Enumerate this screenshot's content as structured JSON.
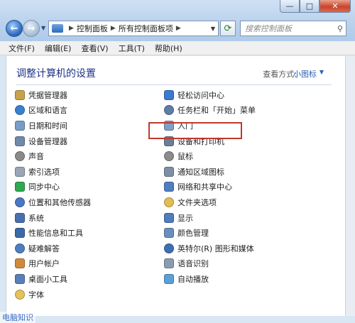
{
  "address": {
    "crumb1": "控制面板",
    "crumb2": "所有控制面板项"
  },
  "search": {
    "placeholder": "搜索控制面板"
  },
  "menu": [
    "文件(F)",
    "编辑(E)",
    "查看(V)",
    "工具(T)",
    "帮助(H)"
  ],
  "heading": "调整计算机的设置",
  "view": {
    "label": "查看方式:",
    "value": "小图标"
  },
  "items_left": [
    {
      "label": "凭据管理器",
      "color": "#c8a24a"
    },
    {
      "label": "区域和语言",
      "color": "#3b7fd1"
    },
    {
      "label": "日期和时间",
      "color": "#7a9cc6"
    },
    {
      "label": "设备管理器",
      "color": "#6f8aa8"
    },
    {
      "label": "声音",
      "color": "#8a8a8a"
    },
    {
      "label": "索引选项",
      "color": "#9aa6b5"
    },
    {
      "label": "同步中心",
      "color": "#2fa84f"
    },
    {
      "label": "位置和其他传感器",
      "color": "#4b78c2"
    },
    {
      "label": "系统",
      "color": "#4a6fb0"
    },
    {
      "label": "性能信息和工具",
      "color": "#3b6aa8"
    },
    {
      "label": "疑难解答",
      "color": "#4d7fc0"
    },
    {
      "label": "用户帐户",
      "color": "#d08a3a"
    },
    {
      "label": "桌面小工具",
      "color": "#5a7fb8"
    },
    {
      "label": "字体",
      "color": "#e3c35a"
    }
  ],
  "items_right": [
    {
      "label": "轻松访问中心",
      "color": "#3a7ad0"
    },
    {
      "label": "任务栏和「开始」菜单",
      "color": "#5c7ea8"
    },
    {
      "label": "入门",
      "color": "#7f9ec9"
    },
    {
      "label": "设备和打印机",
      "color": "#6b7f95"
    },
    {
      "label": "鼠标",
      "color": "#8c8c8c"
    },
    {
      "label": "通知区域图标",
      "color": "#7d8fa6"
    },
    {
      "label": "网络和共享中心",
      "color": "#4f7fbf"
    },
    {
      "label": "文件夹选项",
      "color": "#e0bd55"
    },
    {
      "label": "显示",
      "color": "#4e7dc0"
    },
    {
      "label": "颜色管理",
      "color": "#6a8fbf"
    },
    {
      "label": "英特尔(R) 图形和媒体",
      "color": "#3d6fb5"
    },
    {
      "label": "语音识别",
      "color": "#8b9bb0"
    },
    {
      "label": "自动播放",
      "color": "#5aa0d8"
    }
  ],
  "watermark": "电脑知识",
  "colors": {
    "accent": "#1e3287",
    "highlight_box": "#c0392b"
  }
}
